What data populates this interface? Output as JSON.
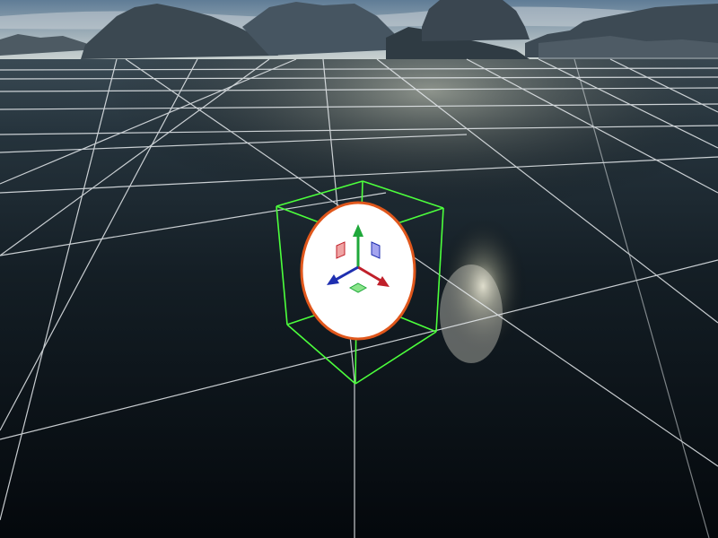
{
  "viewport": {
    "name": "3d-scene-viewport",
    "grid_visible": true,
    "selection_bounds_visible": true,
    "transform_gizmo_visible": true
  },
  "colors": {
    "sky_top": "#6f8aa4",
    "sky_horizon": "#c9d2d2",
    "mountain": "#3e4b55",
    "water_far": "#2a3a45",
    "water_near": "#060b10",
    "grid_line": "#e8ecef",
    "bounding_box": "#4cff3c",
    "sphere_fill": "#ffffff",
    "sphere_outline": "#e0571c",
    "axis_x": "#c0202a",
    "axis_y": "#1fa83a",
    "axis_z": "#1f2fb0",
    "plane_xy": "#e25a5a",
    "plane_yz": "#5a5ae2",
    "plane_xz": "#5ad85a"
  },
  "gizmo": {
    "axes": [
      "x-axis-arrow",
      "y-axis-arrow",
      "z-axis-arrow"
    ],
    "planes": [
      "xy-plane-handle",
      "yz-plane-handle",
      "xz-plane-handle"
    ]
  }
}
